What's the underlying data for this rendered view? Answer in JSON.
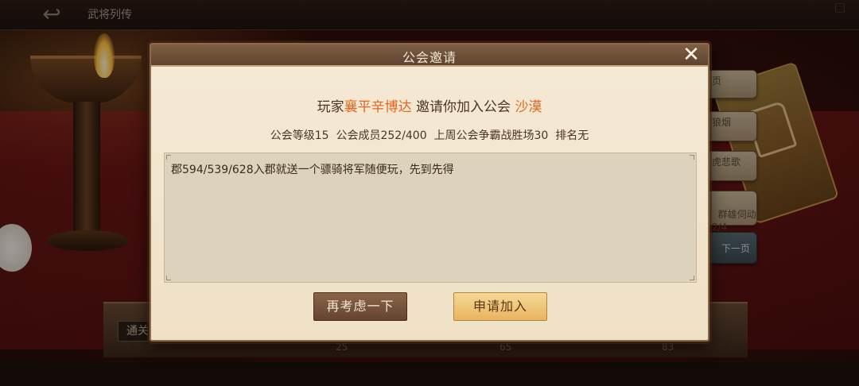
{
  "background": {
    "page_title": "武将列传",
    "back_icon": "back-arrow-icon",
    "board_label": "通关",
    "stage_numbers": [
      "25",
      "65",
      "83"
    ],
    "side_buttons": [
      "页",
      "狼烟",
      "虎悲歌",
      "群雄伺动\n2/4",
      "下一页"
    ]
  },
  "dialog": {
    "title": "公会邀请",
    "close_icon": "close-icon",
    "invite_prefix": "玩家",
    "player_name": "襄平辛博达",
    "invite_middle": " 邀请你加入公会 ",
    "guild_name": "沙漠",
    "stats": "公会等级15  公会成员252/400  上周公会争霸战胜场30  排名无",
    "message": "郡594/539/628入郡就送一个骠骑将军随便玩，先到先得",
    "buttons": {
      "reconsider": "再考虑一下",
      "apply": "申请加入"
    },
    "colors": {
      "highlight": "#e4661c",
      "header": "#6e503a",
      "panel": "#f3e8d2"
    }
  }
}
